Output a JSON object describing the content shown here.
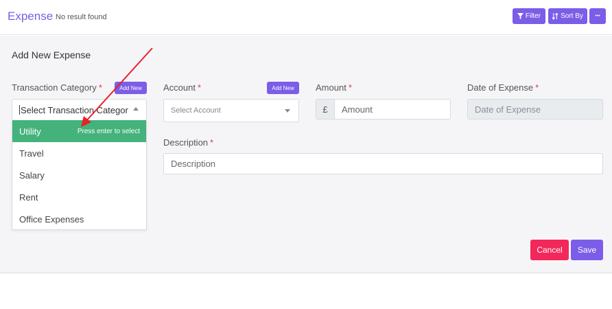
{
  "header": {
    "title": "Expense",
    "subtitle": "No result found",
    "filter_label": "Filter",
    "sort_label": "Sort By",
    "more_label": "•••"
  },
  "form": {
    "section_title": "Add New Expense",
    "required_mark": "*",
    "category": {
      "label": "Transaction Category",
      "add_new": "Add New",
      "value": "Select Transaction Categor"
    },
    "account": {
      "label": "Account",
      "add_new": "Add New",
      "placeholder": "Select Account"
    },
    "amount": {
      "label": "Amount",
      "currency": "£",
      "placeholder": "Amount"
    },
    "date": {
      "label": "Date of Expense",
      "placeholder": "Date of Expense"
    },
    "description": {
      "label": "Description",
      "placeholder": "Description"
    }
  },
  "dropdown": {
    "hint": "Press enter to select",
    "options": [
      "Utility",
      "Travel",
      "Salary",
      "Rent",
      "Office Expenses"
    ]
  },
  "footer": {
    "cancel": "Cancel",
    "save": "Save"
  },
  "colors": {
    "primary": "#7b5de8",
    "highlight": "#44b27b",
    "danger": "#f2285a",
    "annotation": "#e8202a"
  }
}
